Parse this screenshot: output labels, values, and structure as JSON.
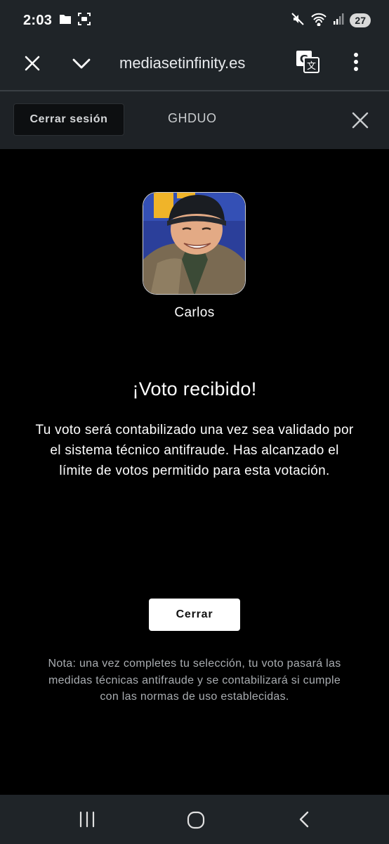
{
  "status_bar": {
    "time": "2:03",
    "battery": "27",
    "icons": [
      "folder-icon",
      "screenshot-icon",
      "mute-icon",
      "wifi-icon",
      "signal-icon"
    ]
  },
  "browser": {
    "url": "mediasetinfinity.es",
    "icons": [
      "close-icon",
      "chevron-down-icon",
      "translate-icon",
      "more-vert-icon"
    ]
  },
  "session": {
    "logout_label": "Cerrar sesión",
    "username": "GHDUO"
  },
  "main": {
    "candidate_name": "Carlos",
    "title": "¡Voto recibido!",
    "message": "Tu voto será contabilizado una vez sea validado por el sistema técnico antifraude. Has alcanzado el límite de votos permitido para esta votación.",
    "close_label": "Cerrar",
    "note": "Nota: una vez completes tu selección, tu voto pasará las medidas técnicas antifraude y se contabilizará si cumple con las normas de uso establecidas."
  },
  "nav_bar": {
    "icons": [
      "recent-apps-icon",
      "home-icon",
      "back-icon"
    ]
  }
}
